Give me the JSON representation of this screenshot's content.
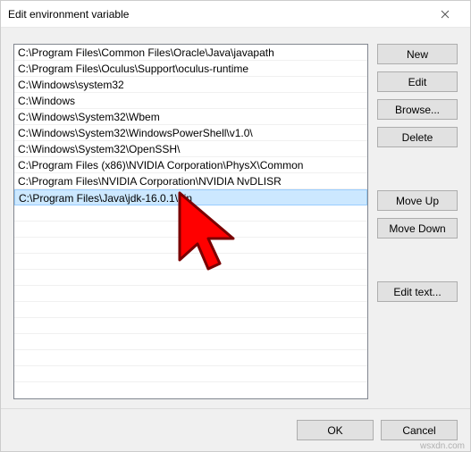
{
  "window": {
    "title": "Edit environment variable"
  },
  "list": {
    "items": [
      "C:\\Program Files\\Common Files\\Oracle\\Java\\javapath",
      "C:\\Program Files\\Oculus\\Support\\oculus-runtime",
      "C:\\Windows\\system32",
      "C:\\Windows",
      "C:\\Windows\\System32\\Wbem",
      "C:\\Windows\\System32\\WindowsPowerShell\\v1.0\\",
      "C:\\Windows\\System32\\OpenSSH\\",
      "C:\\Program Files (x86)\\NVIDIA Corporation\\PhysX\\Common",
      "C:\\Program Files\\NVIDIA Corporation\\NVIDIA NvDLISR",
      "C:\\Program Files\\Java\\jdk-16.0.1\\bin"
    ],
    "selected_index": 9
  },
  "buttons": {
    "new": "New",
    "edit": "Edit",
    "browse": "Browse...",
    "delete": "Delete",
    "move_up": "Move Up",
    "move_down": "Move Down",
    "edit_text": "Edit text...",
    "ok": "OK",
    "cancel": "Cancel"
  },
  "watermark": "wsxdn.com"
}
